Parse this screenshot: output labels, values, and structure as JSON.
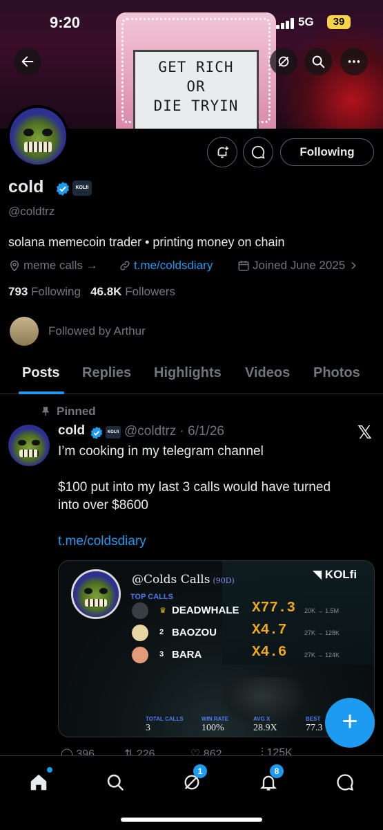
{
  "status_bar": {
    "time": "9:20",
    "network": "5G",
    "battery": "39"
  },
  "banner": {
    "sign_lines": [
      "GET RICH",
      "OR",
      "DIE TRYIN"
    ]
  },
  "profile": {
    "display_name": "cold",
    "handle": "@coldtrz",
    "badge_label": "KOLfi",
    "bio": "solana memecoin trader • printing money on chain",
    "location": "meme calls →",
    "website": "t.me/coldsdiary",
    "joined": "Joined June 2025",
    "following_count": "793",
    "following_label": "Following",
    "followers_count": "46.8K",
    "followers_label": "Followers",
    "followed_by": "Followed by Arthur",
    "follow_button": "Following"
  },
  "tabs": [
    "Posts",
    "Replies",
    "Highlights",
    "Videos",
    "Photos"
  ],
  "pinned_post": {
    "pinned_label": "Pinned",
    "author": "cold",
    "handle_date": "@coldtrz · 6/1/26",
    "line1": "I’m cooking in my telegram channel",
    "line2": "$100 put into my last 3 calls would have turned",
    "line3": "into over $8600",
    "link": "t.me/coldsdiary",
    "engagement": {
      "replies": "396",
      "reposts": "226",
      "likes": "862",
      "views": "125K"
    }
  },
  "card": {
    "title": "@Colds Calls",
    "period": "(90D)",
    "brand": "KOLfi",
    "top_calls_label": "TOP CALLS",
    "calls": [
      {
        "rank": "",
        "coin": "DEADWHALE",
        "mult": "X77.3",
        "range": "20K → 1.5M"
      },
      {
        "rank": "2",
        "coin": "BAOZOU",
        "mult": "X4.7",
        "range": "27K → 128K"
      },
      {
        "rank": "3",
        "coin": "BARA",
        "mult": "X4.6",
        "range": "27K → 124K"
      }
    ],
    "stats": [
      {
        "label": "TOTAL CALLS",
        "value": "3"
      },
      {
        "label": "WIN RATE",
        "value": "100%"
      },
      {
        "label": "AVG X",
        "value": "28.9X"
      },
      {
        "label": "BEST",
        "value": "77.3"
      }
    ]
  },
  "nav": {
    "messages_badge": "1",
    "notifications_badge": "8"
  },
  "colors": {
    "accent": "#1d9bf0",
    "gold": "#f0a81b",
    "muted": "#71767b"
  }
}
